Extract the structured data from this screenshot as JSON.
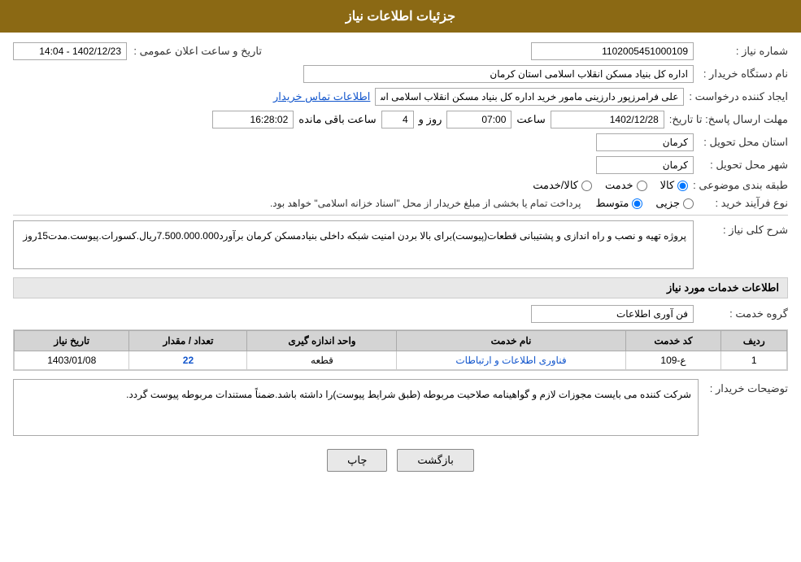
{
  "header": {
    "title": "جزئیات اطلاعات نیاز"
  },
  "fields": {
    "need_number_label": "شماره نیاز :",
    "need_number_value": "1102005451000109",
    "buyer_name_label": "نام دستگاه خریدار :",
    "buyer_name_value": "اداره کل بنیاد مسکن انقلاب اسلامی استان کرمان",
    "creator_label": "ایجاد کننده درخواست :",
    "creator_value": "علی فرامرزپور دارزینی مامور خرید اداره کل بنیاد مسکن انقلاب اسلامی استان ک",
    "creator_link": "اطلاعات تماس خریدار",
    "deadline_label": "مهلت ارسال پاسخ: تا تاریخ:",
    "date_value": "1402/12/28",
    "time_label": "ساعت",
    "time_value": "07:00",
    "day_label": "روز و",
    "day_value": "4",
    "remain_label": "ساعت باقی مانده",
    "remain_value": "16:28:02",
    "announcement_label": "تاریخ و ساعت اعلان عمومی :",
    "announcement_value": "1402/12/23 - 14:04",
    "province_label": "استان محل تحویل :",
    "province_value": "کرمان",
    "city_label": "شهر محل تحویل :",
    "city_value": "کرمان",
    "category_label": "طبقه بندی موضوعی :",
    "category_options": [
      "کالا",
      "خدمت",
      "کالا/خدمت"
    ],
    "category_selected": "کالا",
    "process_label": "نوع فرآیند خرید :",
    "process_options": [
      "جزیی",
      "متوسط"
    ],
    "process_selected": "متوسط",
    "process_note": "پرداخت تمام یا بخشی از مبلغ خریدار از محل \"اسناد خزانه اسلامی\" خواهد بود.",
    "description_label": "شرح کلی نیاز :",
    "description_value": "پروژه تهیه و نصب و راه اندازی و پشتیبانی قطعات(پیوست)برای بالا بردن امنیت شبکه داخلی بنیادمسکن کرمان برآورد7.500.000.000ریال.کسورات.پیوست.مدت15روز",
    "services_section": "اطلاعات خدمات مورد نیاز",
    "service_group_label": "گروه خدمت :",
    "service_group_value": "فن آوری اطلاعات",
    "table_headers": [
      "ردیف",
      "کد خدمت",
      "نام خدمت",
      "واحد اندازه گیری",
      "تعداد / مقدار",
      "تاریخ نیاز"
    ],
    "table_rows": [
      {
        "row": "1",
        "code": "ع-109",
        "name": "فناوری اطلاعات و ارتباطات",
        "unit": "قطعه",
        "quantity": "22",
        "date": "1403/01/08"
      }
    ],
    "buyer_notes_label": "توضیحات خریدار :",
    "buyer_notes_value": "شرکت کننده می بایست مجوزات لازم  و  گواهینامه صلاحیت مربوطه (طبق شرایط پیوست)را داشته باشد.ضمناً مستندات مربوطه پیوست گردد."
  },
  "buttons": {
    "print_label": "چاپ",
    "back_label": "بازگشت"
  }
}
